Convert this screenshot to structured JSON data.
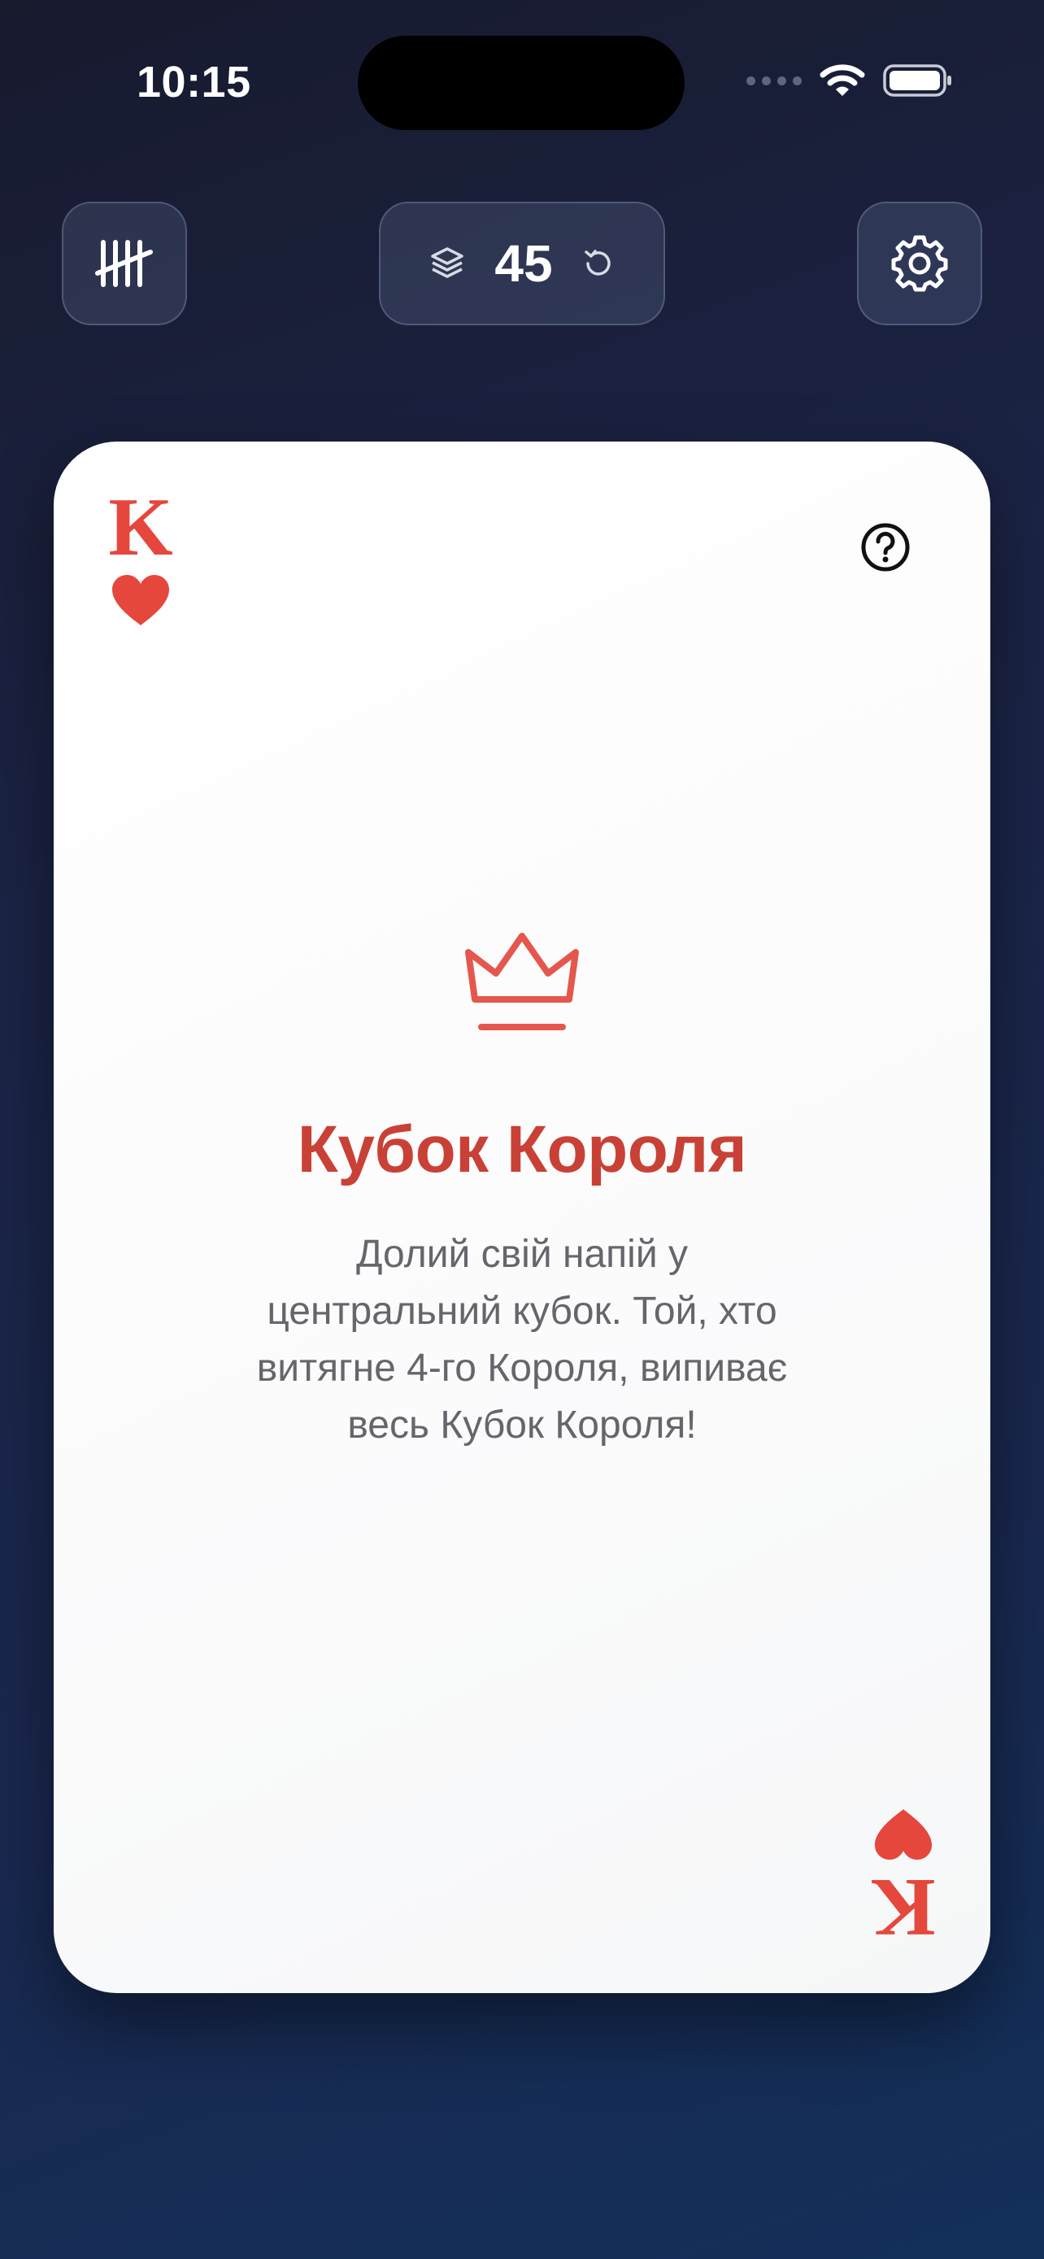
{
  "status_bar": {
    "time": "10:15"
  },
  "header": {
    "tally_button": {
      "icon": "tally-marks-icon"
    },
    "deck": {
      "icon": "stack-layers-icon",
      "count": "45",
      "reset_icon": "reset-arrow-icon"
    },
    "settings_button": {
      "icon": "gear-icon"
    }
  },
  "card": {
    "rank": "K",
    "suit": "hearts",
    "suit_icon": "heart-icon",
    "help_icon": "question-circle-icon",
    "center_icon": "crown-icon",
    "title": "Кубок Короля",
    "description": "Долий свій напій у центральний кубок. Той, хто витягне 4-го Короля, випиває весь Кубок Короля!"
  },
  "colors": {
    "suit_red": "#e5473d",
    "title_red": "#c94136",
    "crown_red": "#e5574d",
    "text_gray": "#65666c",
    "card_bg": "#ffffff"
  }
}
